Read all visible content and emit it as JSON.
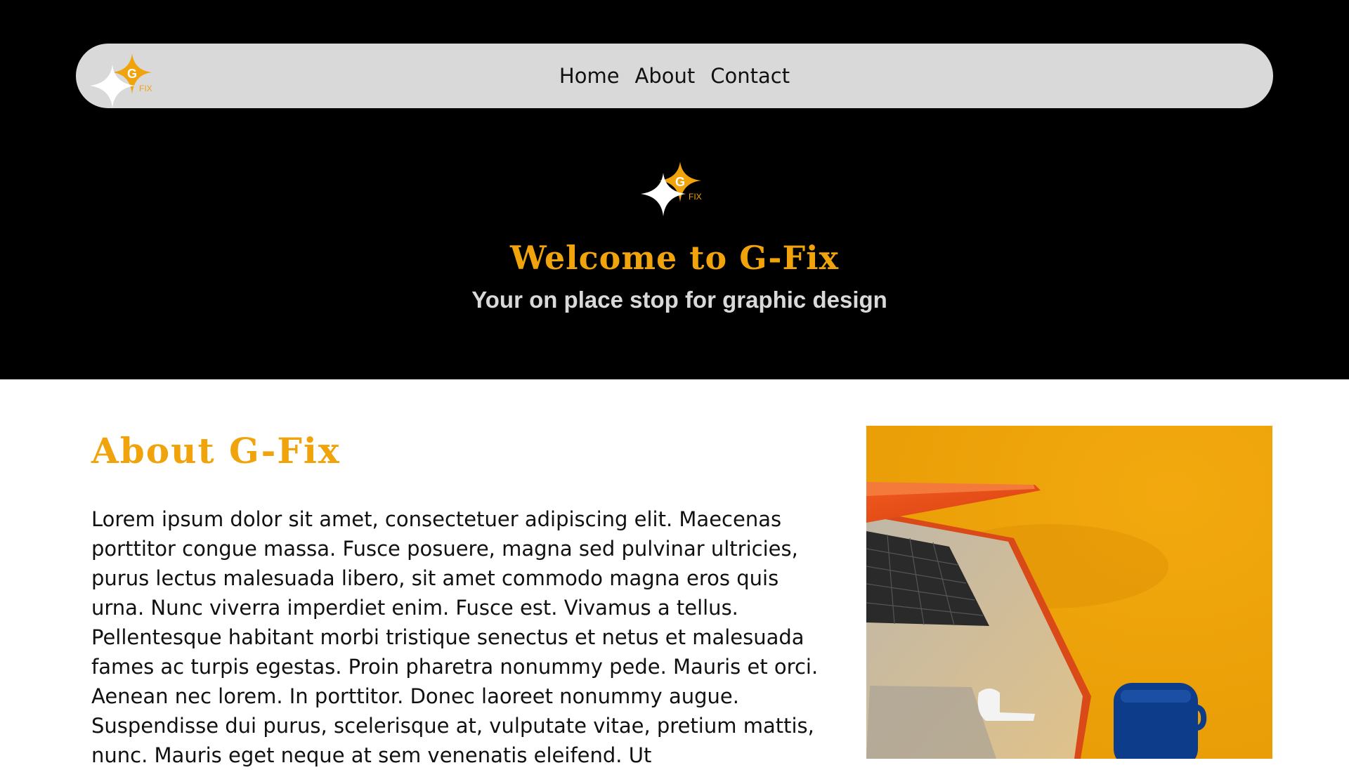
{
  "nav": {
    "logo_letter": "G",
    "logo_sub": "FIX",
    "links": [
      "Home",
      "About",
      "Contact"
    ]
  },
  "hero": {
    "logo_letter": "G",
    "logo_sub": "FIX",
    "title": "Welcome to G-Fix",
    "subtitle": "Your on place stop for graphic design"
  },
  "about": {
    "title": "About G-Fix",
    "body": "Lorem ipsum dolor sit amet, consectetuer adipiscing elit. Maecenas porttitor congue massa. Fusce posuere, magna sed pulvinar ultricies, purus lectus malesuada libero, sit amet commodo magna eros quis urna. Nunc viverra imperdiet enim. Fusce est. Vivamus a tellus. Pellentesque habitant morbi tristique senectus et netus et malesuada fames ac turpis egestas. Proin pharetra nonummy pede. Mauris et orci. Aenean nec lorem. In porttitor. Donec laoreet nonummy augue. Suspendisse dui purus, scelerisque at, vulputate vitae, pretium mattis, nunc. Mauris eget neque at sem venenatis eleifend. Ut"
  },
  "colors": {
    "accent": "#f0a30a",
    "hero_bg": "#000000",
    "nav_bg": "#d9d9d9",
    "subtitle": "#d9d9d9"
  },
  "icons": {
    "logo": "sparkle-star-logo-icon"
  }
}
